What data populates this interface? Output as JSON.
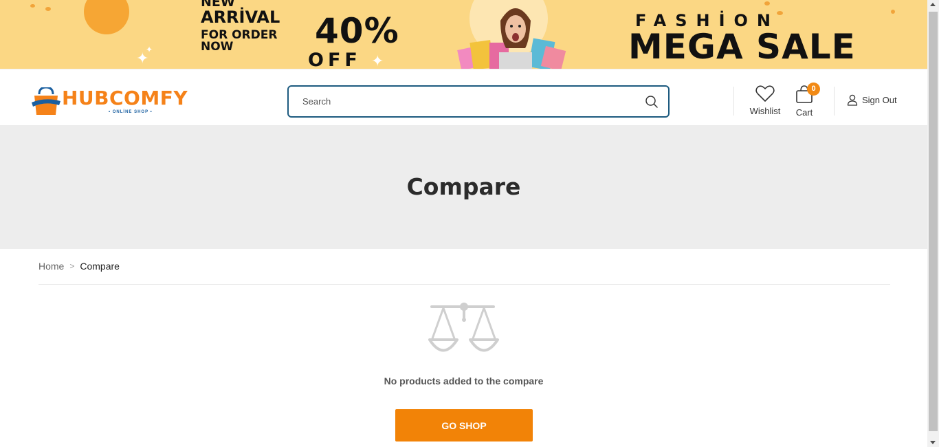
{
  "banner": {
    "new": "NEW",
    "arrival": "ARRİVAL",
    "for_order": "FOR ORDER",
    "now": "NOW",
    "discount": "40%",
    "off": "OFF",
    "fashion": "FASHİON",
    "mega_sale": "MEGA SALE"
  },
  "header": {
    "logo_text": "HUBCOMFY",
    "logo_tagline": "• ONLİNE SHOP •",
    "search_placeholder": "Search",
    "wishlist_label": "Wishlist",
    "cart_label": "Cart",
    "cart_count": "0",
    "signout_label": "Sign Out"
  },
  "page": {
    "title": "Compare"
  },
  "breadcrumb": {
    "home": "Home",
    "separator": ">",
    "current": "Compare"
  },
  "empty_state": {
    "message": "No products added to the compare",
    "button_label": "GO SHOP"
  },
  "colors": {
    "accent": "#f28307",
    "banner_bg": "#fbd784",
    "search_border": "#1c5a7f",
    "logo_orange": "#f58219",
    "logo_blue": "#1a5fa0"
  }
}
